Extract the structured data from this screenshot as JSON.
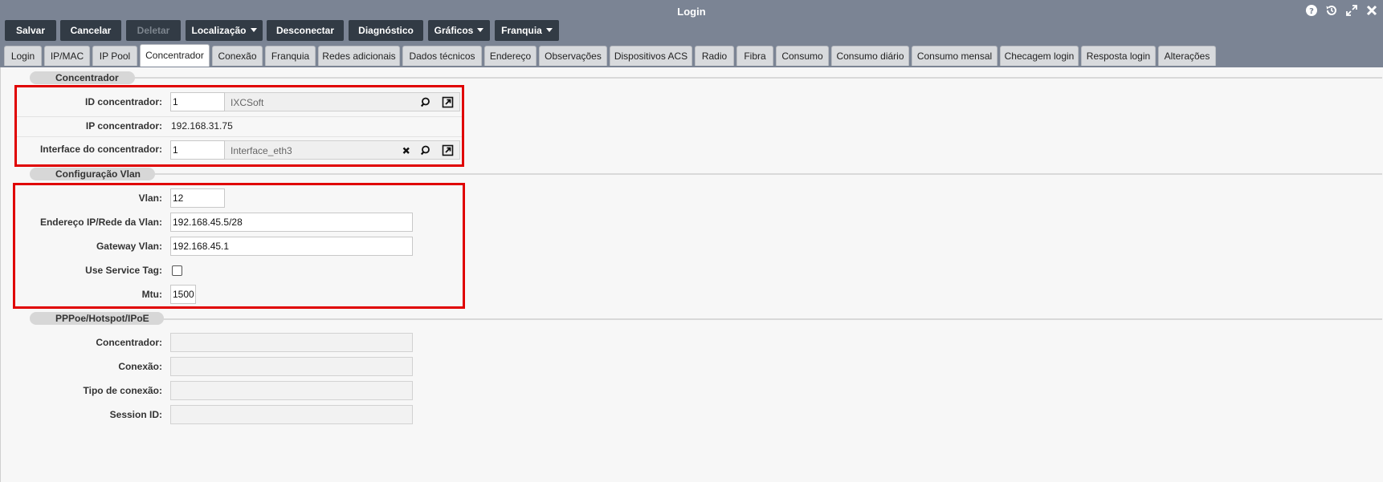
{
  "window": {
    "title": "Login"
  },
  "window_icons": [
    "help-icon",
    "history-icon",
    "maximize-icon",
    "close-icon"
  ],
  "toolbar": [
    {
      "label": "Salvar",
      "dropdown": false,
      "disabled": false
    },
    {
      "label": "Cancelar",
      "dropdown": false,
      "disabled": false
    },
    {
      "label": "Deletar",
      "dropdown": false,
      "disabled": true
    },
    {
      "label": "Localização",
      "dropdown": true,
      "disabled": false
    },
    {
      "label": "Desconectar",
      "dropdown": false,
      "disabled": false
    },
    {
      "label": "Diagnóstico",
      "dropdown": false,
      "disabled": false
    },
    {
      "label": "Gráficos",
      "dropdown": true,
      "disabled": false
    },
    {
      "label": "Franquia",
      "dropdown": true,
      "disabled": false
    }
  ],
  "tabs": [
    "Login",
    "IP/MAC",
    "IP Pool",
    "Concentrador",
    "Conexão",
    "Franquia",
    "Redes adicionais",
    "Dados técnicos",
    "Endereço",
    "Observações",
    "Dispositivos ACS",
    "Radio",
    "Fibra",
    "Consumo",
    "Consumo diário",
    "Consumo mensal",
    "Checagem login",
    "Resposta login",
    "Alterações"
  ],
  "active_tab": "Concentrador",
  "concentrador": {
    "title": "Concentrador",
    "id_label": "ID concentrador:",
    "id_value": "1",
    "id_desc": "IXCSoft",
    "ip_label": "IP concentrador:",
    "ip_value": "192.168.31.75",
    "iface_label": "Interface do concentrador:",
    "iface_value": "1",
    "iface_desc": "Interface_eth3"
  },
  "vlan": {
    "title": "Configuração Vlan",
    "vlan_label": "Vlan:",
    "vlan_value": "12",
    "ip_label": "Endereço IP/Rede da Vlan:",
    "ip_value": "192.168.45.5/28",
    "gw_label": "Gateway Vlan:",
    "gw_value": "192.168.45.1",
    "service_tag_label": "Use Service Tag:",
    "service_tag_checked": false,
    "mtu_label": "Mtu:",
    "mtu_value": "1500"
  },
  "pppoe": {
    "title": "PPPoe/Hotspot/IPoE",
    "concentrador_label": "Concentrador:",
    "concentrador_value": "",
    "conexao_label": "Conexão:",
    "conexao_value": "",
    "tipo_label": "Tipo de conexão:",
    "tipo_value": "",
    "session_label": "Session ID:",
    "session_value": ""
  },
  "colors": {
    "titlebar": "#7b8494",
    "button": "#323b45",
    "highlight": "#e00000"
  }
}
